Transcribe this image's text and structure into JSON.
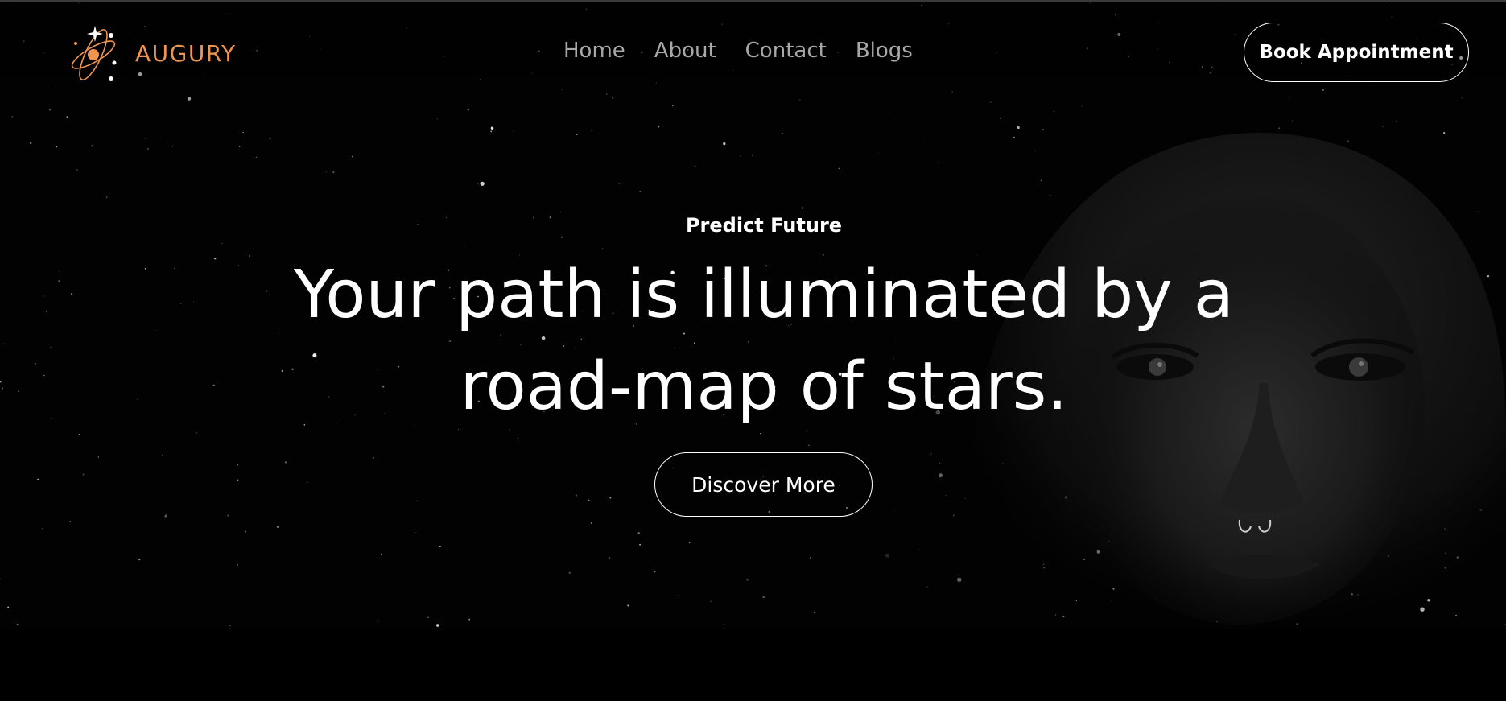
{
  "brand": {
    "name": "AUGURY",
    "logo_icon": "atom-star-logo-icon",
    "accent_color": "#f0954f"
  },
  "nav": {
    "items": [
      {
        "label": "Home"
      },
      {
        "label": "About"
      },
      {
        "label": "Contact"
      },
      {
        "label": "Blogs"
      }
    ],
    "link_color": "#a8a8a8"
  },
  "header": {
    "cta_label": "Book Appointment"
  },
  "hero": {
    "eyebrow": "Predict Future",
    "headline_line1": "Your path is illuminated by a",
    "headline_line2": "road-map of stars.",
    "cta_label": "Discover More",
    "background_color": "#020202",
    "text_color": "#ffffff"
  }
}
